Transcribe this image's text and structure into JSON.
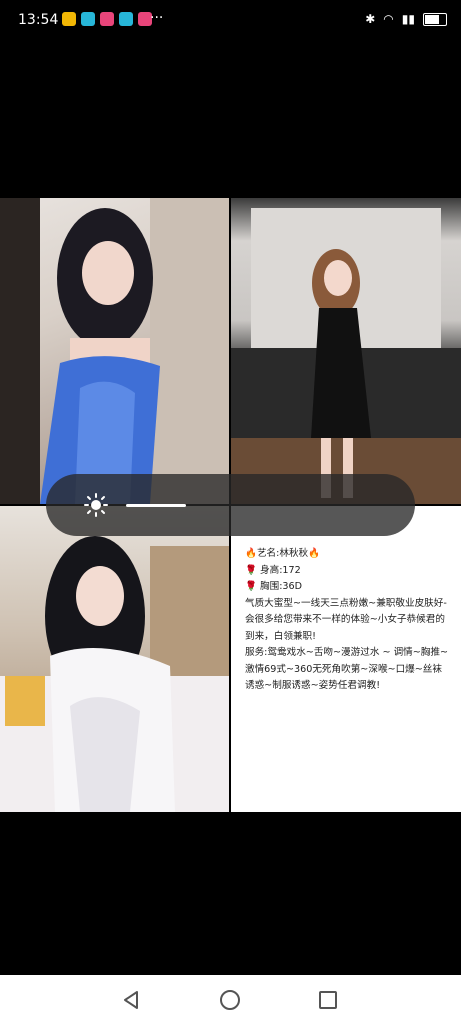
{
  "status_bar": {
    "time": "13:54",
    "more": "···",
    "battery": "75",
    "app_icons": [
      {
        "name": "app-icon-yellow",
        "color": "#f2b705"
      },
      {
        "name": "app-icon-cyan",
        "color": "#27b6d8"
      },
      {
        "name": "app-icon-pink",
        "color": "#e8457a"
      },
      {
        "name": "app-icon-cyan2",
        "color": "#27b6d8"
      },
      {
        "name": "app-icon-pink2",
        "color": "#e8457a"
      }
    ]
  },
  "profile": {
    "name_line": "艺名:林秋秋",
    "height_line": "身高:172",
    "bust_line": "胸围:36D",
    "intro": "气质大蜜型~一线天三点粉嫩~兼职敬业皮肤好-会很多给您带来不一样的体验~小女子恭候君的到来，白领兼职!",
    "services": "服务:鸳鸯戏水~舌吻~漫游过水 ~ 调情~胸推~激情69式~360无死角吹第~深喉~口爆~丝袜诱惑~制服诱惑~姿势任君调教!"
  },
  "brightness": {
    "level": 0.25
  },
  "colors": {
    "fire": "#e8541e",
    "rose": "#c0182a"
  }
}
